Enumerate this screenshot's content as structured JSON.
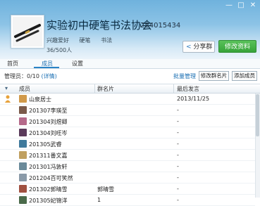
{
  "window": {
    "controls": {
      "minimize": "—",
      "maximize": "□",
      "close": "✕"
    }
  },
  "group": {
    "name": "实验初中硬笔书法协会",
    "id": "284015434",
    "tags": [
      "兴趣爱好",
      "硬笔",
      "书法"
    ],
    "member_count": "36/500人"
  },
  "actions": {
    "share": "分享群",
    "edit": "修改资料"
  },
  "tabs": [
    "首页",
    "成员",
    "设置"
  ],
  "toolbar": {
    "admin_label": "管理员：0/10",
    "admin_link": "(详情)",
    "batch": "批量管理",
    "edit_card": "修改群名片",
    "add_member": "添加成员"
  },
  "table": {
    "headers": {
      "member": "成员",
      "card": "群名片",
      "last_post": "最后发言"
    },
    "rows": [
      {
        "name": "山泉居士",
        "card": "",
        "last": "2013/11/25",
        "color": "#d19a4a"
      },
      {
        "name": "201307李瑛至",
        "card": "",
        "last": "-",
        "color": "#7a5a4a"
      },
      {
        "name": "201304刘煜卿",
        "card": "",
        "last": "-",
        "color": "#b56a8a"
      },
      {
        "name": "201304刘旺岑",
        "card": "",
        "last": "-",
        "color": "#5a3a5a"
      },
      {
        "name": "201305武睿",
        "card": "",
        "last": "-",
        "color": "#3f7a9c"
      },
      {
        "name": "201311番文嘉",
        "card": "",
        "last": "-",
        "color": "#c0a060"
      },
      {
        "name": "201301冯敦轩",
        "card": "",
        "last": "-",
        "color": "#6a8a9a"
      },
      {
        "name": "201204百可笑然",
        "card": "",
        "last": "-",
        "color": "#8a9aa8"
      },
      {
        "name": "201302郭晴雪",
        "card": "郭晴雪",
        "last": "-",
        "color": "#a05040"
      },
      {
        "name": "201305妃锦洋",
        "card": "1",
        "last": "-",
        "color": "#4a6a4a"
      }
    ]
  },
  "colors": {
    "accent": "#1a6fb3",
    "edit_button": "#3aa53e"
  }
}
